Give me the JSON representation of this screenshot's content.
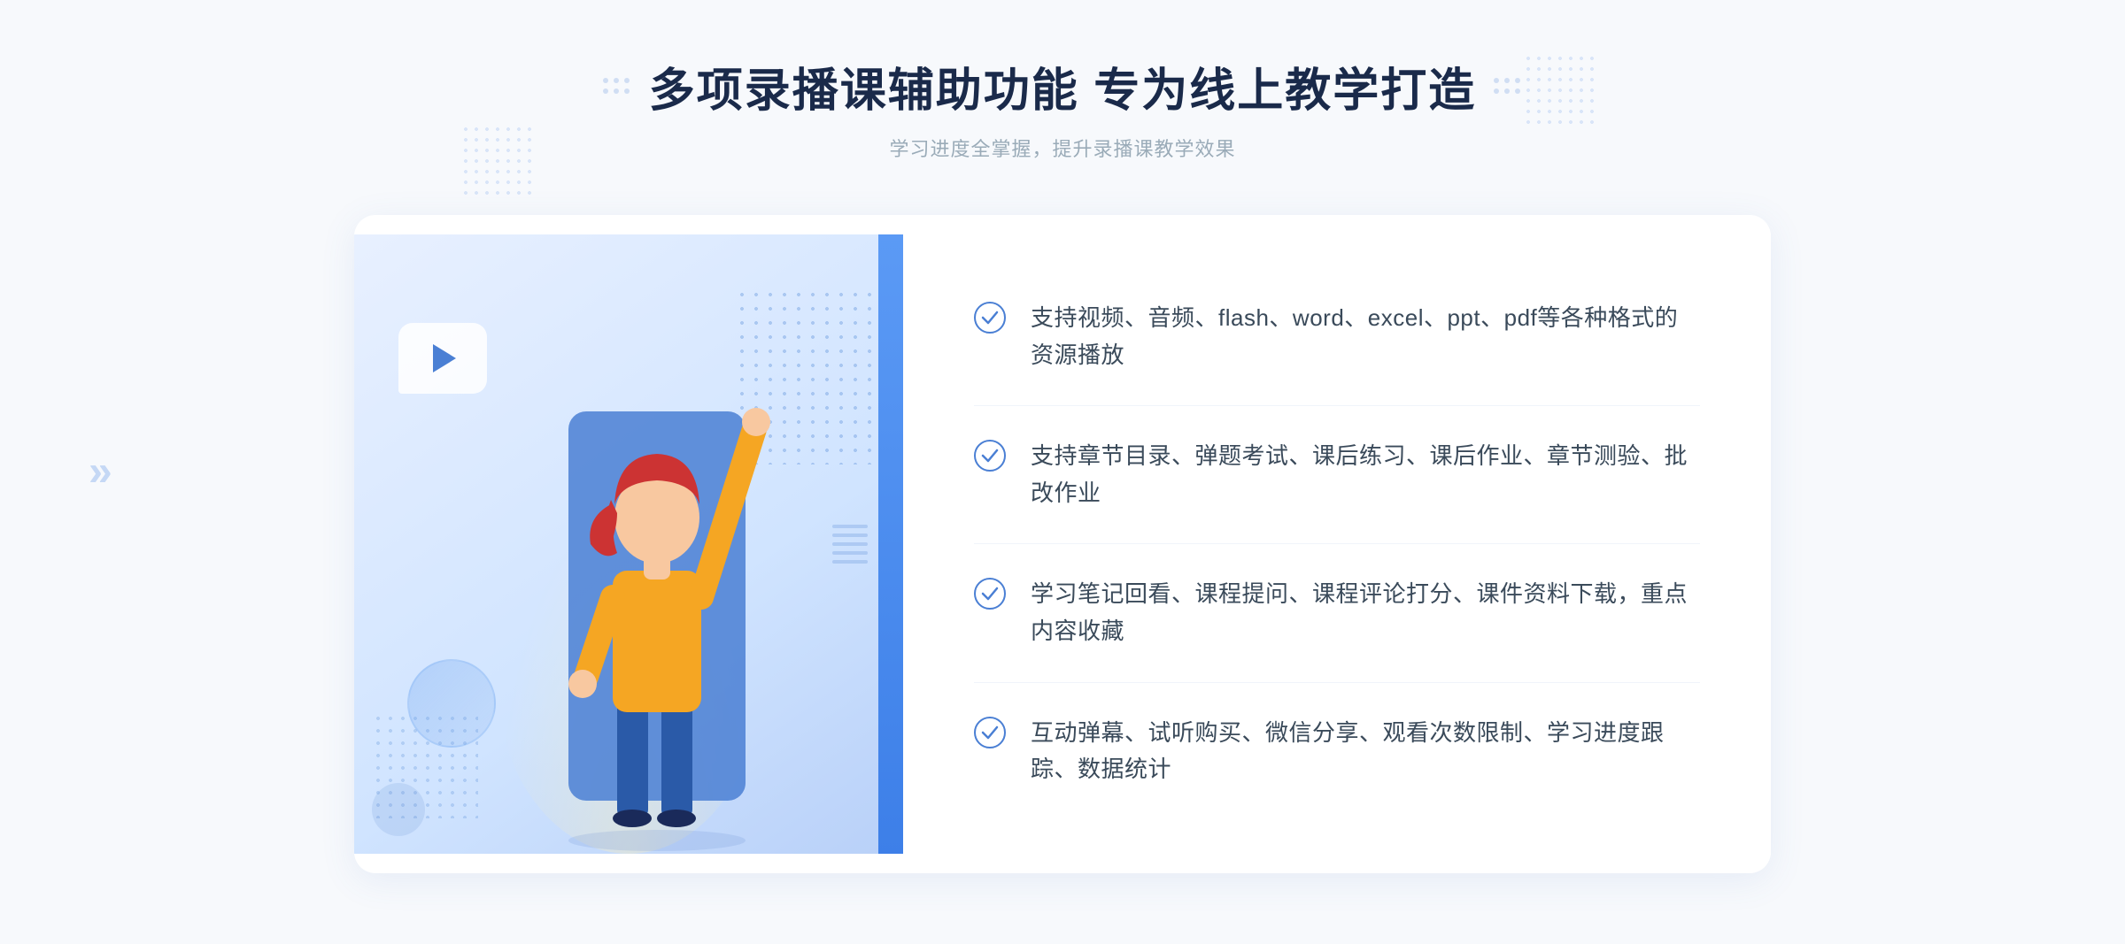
{
  "header": {
    "title": "多项录播课辅助功能 专为线上教学打造",
    "subtitle": "学习进度全掌握，提升录播课教学效果"
  },
  "features": [
    {
      "id": "feature-1",
      "text": "支持视频、音频、flash、word、excel、ppt、pdf等各种格式的资源播放"
    },
    {
      "id": "feature-2",
      "text": "支持章节目录、弹题考试、课后练习、课后作业、章节测验、批改作业"
    },
    {
      "id": "feature-3",
      "text": "学习笔记回看、课程提问、课程评论打分、课件资料下载，重点内容收藏"
    },
    {
      "id": "feature-4",
      "text": "互动弹幕、试听购买、微信分享、观看次数限制、学习进度跟踪、数据统计"
    }
  ],
  "decoration": {
    "chevron_char": "«",
    "play_label": "play-button",
    "check_color": "#4a7fd4",
    "accent_color": "#4a7fd4"
  }
}
